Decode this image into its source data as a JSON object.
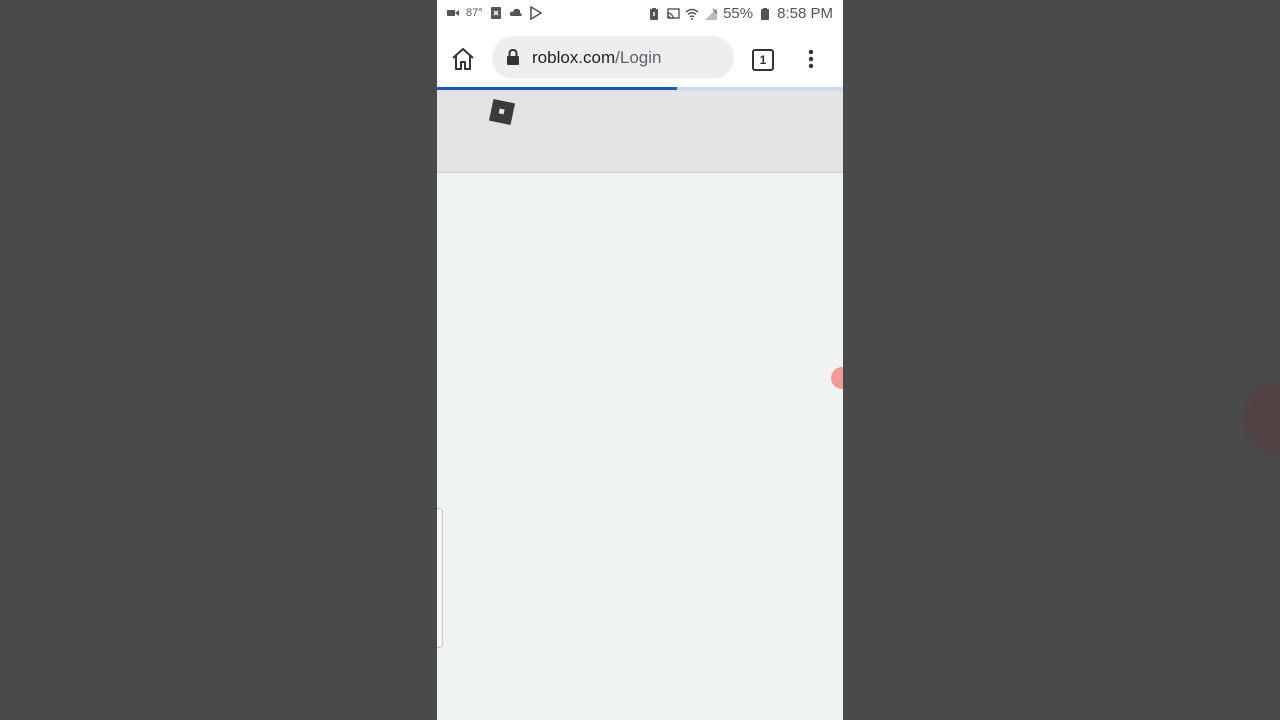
{
  "status_bar": {
    "temperature": "87°",
    "battery": "55%",
    "time": "8:58 PM"
  },
  "browser": {
    "url_domain": "roblox.com",
    "url_path": "/Login",
    "tab_count": "1",
    "load_progress": 0.59
  },
  "icons": {
    "status_left": [
      "video-camera-icon",
      "notification-x-icon",
      "cloud-icon",
      "play-store-icon"
    ],
    "status_right": [
      "battery-alert-icon",
      "cast-icon",
      "wifi-icon",
      "no-signal-icon",
      "battery-icon"
    ],
    "browser": [
      "home-icon",
      "lock-icon",
      "tab-switcher-icon",
      "more-vert-icon"
    ],
    "site": [
      "roblox-logo-icon"
    ]
  },
  "colors": {
    "progress": "#1a56c8",
    "header_bg": "#e1e3e4",
    "page_bg": "#f0f3f4",
    "outside_bg": "#4a4a4c"
  }
}
